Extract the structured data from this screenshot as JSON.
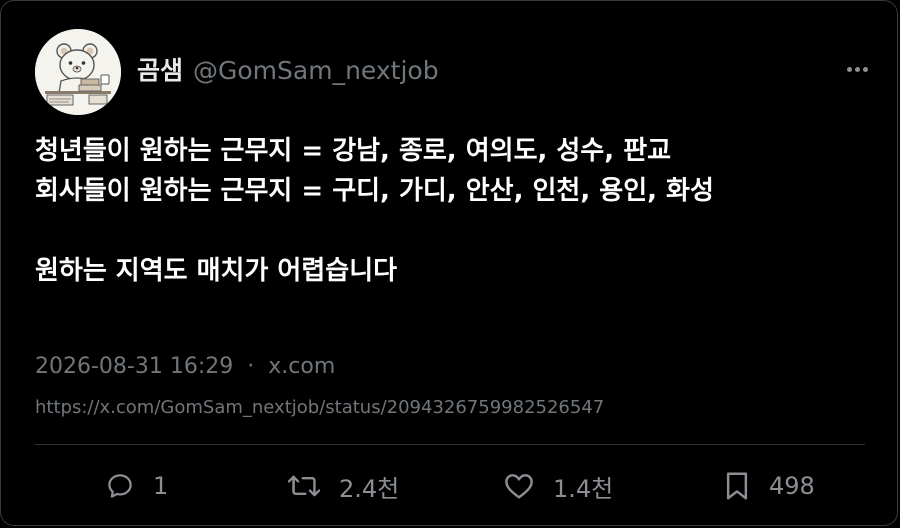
{
  "author": {
    "display_name": "곰샘",
    "handle": "@GomSam_nextjob",
    "avatar": "bear-cartoon-avatar"
  },
  "tweet": {
    "lines": [
      "청년들이 원하는 근무지 = 강남, 종로, 여의도, 성수, 판교",
      "회사들이 원하는 근무지 = 구디, 가디, 안산, 인천, 용인, 화성",
      "원하는 지역도 매치가 어렵습니다"
    ],
    "timestamp": "2026-08-31 16:29",
    "separator": "·",
    "source": "x.com",
    "url": "https://x.com/GomSam_nextjob/status/2094326759982526547"
  },
  "actions": {
    "reply": {
      "icon": "reply-icon",
      "count": "1"
    },
    "retweet": {
      "icon": "retweet-icon",
      "count": "2.4천"
    },
    "like": {
      "icon": "heart-icon",
      "count": "1.4천"
    },
    "bookmark": {
      "icon": "bookmark-icon",
      "count": "498"
    }
  },
  "more_icon": "more-horizontal-icon",
  "colors": {
    "background": "#000000",
    "text": "#e7e9ea",
    "muted": "#71767b",
    "border": "#2f3336"
  }
}
